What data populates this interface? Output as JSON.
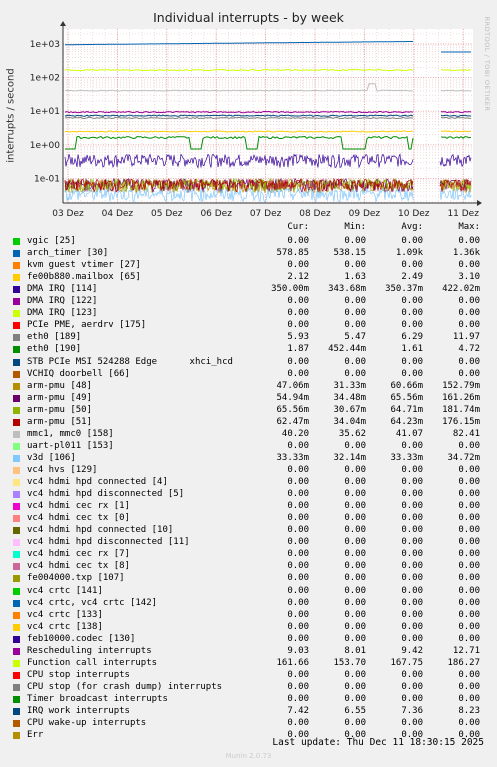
{
  "chart_data": {
    "type": "line",
    "title": "Individual interrupts - by week",
    "ylabel": "interrupts / second",
    "yscale": "log",
    "ylim": [
      0.05,
      3000
    ],
    "yticks": [
      "1e+03",
      "1e+02",
      "1e+01",
      "1e+00",
      "1e-01"
    ],
    "xticks": [
      "03 Dez",
      "04 Dez",
      "05 Dez",
      "06 Dez",
      "07 Dez",
      "08 Dez",
      "09 Dez",
      "10 Dez",
      "11 Dez"
    ],
    "grid": true,
    "side_text": "RRDTOOL / TOBI OETIKER",
    "columns": [
      "Cur:",
      "Min:",
      "Avg:",
      "Max:"
    ],
    "series": [
      {
        "name": "vgic [25]",
        "color": "#00cc00",
        "cur": "0.00",
        "min": "0.00",
        "avg": "0.00",
        "max": "0.00"
      },
      {
        "name": "arch_timer [30]",
        "color": "#0066b3",
        "cur": "578.85",
        "min": "538.15",
        "avg": "1.09k",
        "max": "1.36k"
      },
      {
        "name": "kvm guest vtimer [27]",
        "color": "#ff8000",
        "cur": "0.00",
        "min": "0.00",
        "avg": "0.00",
        "max": "0.00"
      },
      {
        "name": "fe00b880.mailbox [65]",
        "color": "#ffcc00",
        "cur": "2.12",
        "min": "1.63",
        "avg": "2.49",
        "max": "3.10"
      },
      {
        "name": "DMA IRQ [114]",
        "color": "#330099",
        "cur": "350.00m",
        "min": "343.68m",
        "avg": "350.37m",
        "max": "422.02m"
      },
      {
        "name": "DMA IRQ [122]",
        "color": "#990099",
        "cur": "0.00",
        "min": "0.00",
        "avg": "0.00",
        "max": "0.00"
      },
      {
        "name": "DMA IRQ [123]",
        "color": "#ccff00",
        "cur": "0.00",
        "min": "0.00",
        "avg": "0.00",
        "max": "0.00"
      },
      {
        "name": "PCIe PME, aerdrv [175]",
        "color": "#ff0000",
        "cur": "0.00",
        "min": "0.00",
        "avg": "0.00",
        "max": "0.00"
      },
      {
        "name": "eth0 [189]",
        "color": "#808080",
        "cur": "5.93",
        "min": "5.47",
        "avg": "6.29",
        "max": "11.97"
      },
      {
        "name": "eth0 [190]",
        "color": "#008f00",
        "cur": "1.87",
        "min": "452.44m",
        "avg": "1.61",
        "max": "4.72"
      },
      {
        "name": "STB PCIe MSI 524288 Edge      xhci_hcd",
        "color": "#00487d",
        "cur": "0.00",
        "min": "0.00",
        "avg": "0.00",
        "max": "0.00"
      },
      {
        "name": "VCHIQ doorbell [66]",
        "color": "#b35a00",
        "cur": "0.00",
        "min": "0.00",
        "avg": "0.00",
        "max": "0.00"
      },
      {
        "name": "arm-pmu [48]",
        "color": "#b38f00",
        "cur": "47.06m",
        "min": "31.33m",
        "avg": "60.66m",
        "max": "152.79m"
      },
      {
        "name": "arm-pmu [49]",
        "color": "#6b006b",
        "cur": "54.94m",
        "min": "34.48m",
        "avg": "65.56m",
        "max": "161.26m"
      },
      {
        "name": "arm-pmu [50]",
        "color": "#8fb300",
        "cur": "65.56m",
        "min": "30.67m",
        "avg": "64.71m",
        "max": "181.74m"
      },
      {
        "name": "arm-pmu [51]",
        "color": "#b30000",
        "cur": "62.47m",
        "min": "34.04m",
        "avg": "64.23m",
        "max": "176.15m"
      },
      {
        "name": "mmc1, mmc0 [158]",
        "color": "#bebebe",
        "cur": "40.20",
        "min": "35.62",
        "avg": "41.07",
        "max": "82.41"
      },
      {
        "name": "uart-pl011 [153]",
        "color": "#80ff80",
        "cur": "0.00",
        "min": "0.00",
        "avg": "0.00",
        "max": "0.00"
      },
      {
        "name": "v3d [106]",
        "color": "#80c9ff",
        "cur": "33.33m",
        "min": "32.14m",
        "avg": "33.33m",
        "max": "34.72m"
      },
      {
        "name": "vc4 hvs [129]",
        "color": "#ffc080",
        "cur": "0.00",
        "min": "0.00",
        "avg": "0.00",
        "max": "0.00"
      },
      {
        "name": "vc4 hdmi hpd connected [4]",
        "color": "#ffe680",
        "cur": "0.00",
        "min": "0.00",
        "avg": "0.00",
        "max": "0.00"
      },
      {
        "name": "vc4 hdmi hpd disconnected [5]",
        "color": "#aa80ff",
        "cur": "0.00",
        "min": "0.00",
        "avg": "0.00",
        "max": "0.00"
      },
      {
        "name": "vc4 hdmi cec rx [1]",
        "color": "#ee00cc",
        "cur": "0.00",
        "min": "0.00",
        "avg": "0.00",
        "max": "0.00"
      },
      {
        "name": "vc4 hdmi cec tx [0]",
        "color": "#ff8080",
        "cur": "0.00",
        "min": "0.00",
        "avg": "0.00",
        "max": "0.00"
      },
      {
        "name": "vc4 hdmi hpd connected [10]",
        "color": "#666600",
        "cur": "0.00",
        "min": "0.00",
        "avg": "0.00",
        "max": "0.00"
      },
      {
        "name": "vc4 hdmi hpd disconnected [11]",
        "color": "#ffbfff",
        "cur": "0.00",
        "min": "0.00",
        "avg": "0.00",
        "max": "0.00"
      },
      {
        "name": "vc4 hdmi cec rx [7]",
        "color": "#00ffcc",
        "cur": "0.00",
        "min": "0.00",
        "avg": "0.00",
        "max": "0.00"
      },
      {
        "name": "vc4 hdmi cec tx [8]",
        "color": "#cc6699",
        "cur": "0.00",
        "min": "0.00",
        "avg": "0.00",
        "max": "0.00"
      },
      {
        "name": "fe004000.txp [107]",
        "color": "#999900",
        "cur": "0.00",
        "min": "0.00",
        "avg": "0.00",
        "max": "0.00"
      },
      {
        "name": "vc4 crtc [141]",
        "color": "#00cc00",
        "cur": "0.00",
        "min": "0.00",
        "avg": "0.00",
        "max": "0.00"
      },
      {
        "name": "vc4 crtc, vc4 crtc [142]",
        "color": "#0066b3",
        "cur": "0.00",
        "min": "0.00",
        "avg": "0.00",
        "max": "0.00"
      },
      {
        "name": "vc4 crtc [133]",
        "color": "#ff8000",
        "cur": "0.00",
        "min": "0.00",
        "avg": "0.00",
        "max": "0.00"
      },
      {
        "name": "vc4 crtc [138]",
        "color": "#ffcc00",
        "cur": "0.00",
        "min": "0.00",
        "avg": "0.00",
        "max": "0.00"
      },
      {
        "name": "feb10000.codec [130]",
        "color": "#330099",
        "cur": "0.00",
        "min": "0.00",
        "avg": "0.00",
        "max": "0.00"
      },
      {
        "name": "Rescheduling interrupts",
        "color": "#990099",
        "cur": "9.03",
        "min": "8.01",
        "avg": "9.42",
        "max": "12.71"
      },
      {
        "name": "Function call interrupts",
        "color": "#ccff00",
        "cur": "161.66",
        "min": "153.70",
        "avg": "167.75",
        "max": "186.27"
      },
      {
        "name": "CPU stop interrupts",
        "color": "#ff0000",
        "cur": "0.00",
        "min": "0.00",
        "avg": "0.00",
        "max": "0.00"
      },
      {
        "name": "CPU stop (for crash dump) interrupts",
        "color": "#808080",
        "cur": "0.00",
        "min": "0.00",
        "avg": "0.00",
        "max": "0.00"
      },
      {
        "name": "Timer broadcast interrupts",
        "color": "#008f00",
        "cur": "0.00",
        "min": "0.00",
        "avg": "0.00",
        "max": "0.00"
      },
      {
        "name": "IRQ work interrupts",
        "color": "#00487d",
        "cur": "7.42",
        "min": "6.55",
        "avg": "7.36",
        "max": "8.23"
      },
      {
        "name": "CPU wake-up interrupts",
        "color": "#b35a00",
        "cur": "0.00",
        "min": "0.00",
        "avg": "0.00",
        "max": "0.00"
      },
      {
        "name": "Err",
        "color": "#b38f00",
        "cur": "0.00",
        "min": "0.00",
        "avg": "0.00",
        "max": "0.00"
      }
    ]
  },
  "footer": {
    "last_update": "Last update: Thu Dec 11 18:30:15 2025",
    "generator": "Munin 2.0.73"
  }
}
